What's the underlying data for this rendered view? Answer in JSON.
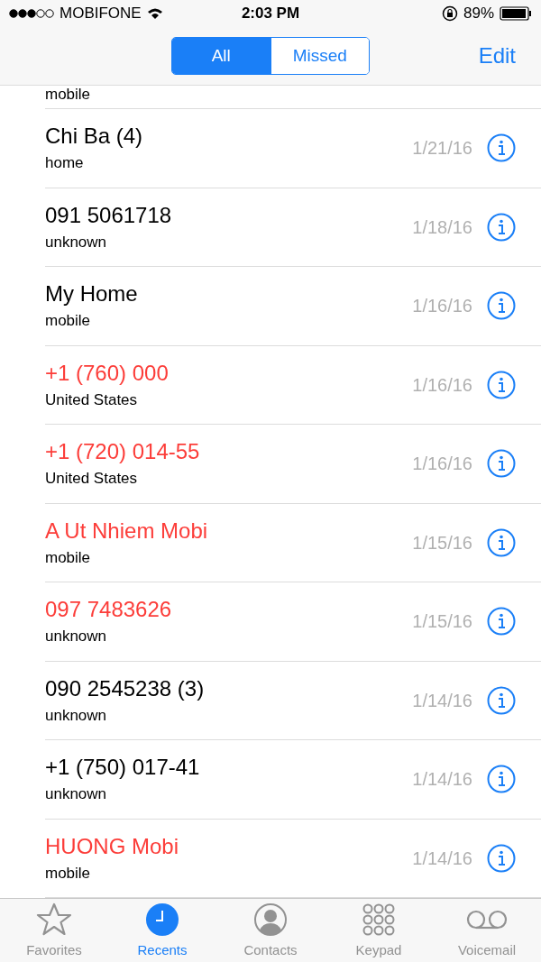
{
  "status_bar": {
    "carrier": "MOBIFONE",
    "time": "2:03 PM",
    "battery": "89%"
  },
  "segments": [
    {
      "label": "All",
      "selected": true
    },
    {
      "label": "Missed",
      "selected": false
    }
  ],
  "edit": "Edit",
  "partial_row": {
    "type": "mobile"
  },
  "calls": [
    {
      "name": "Chi Ba (4)",
      "type": "home",
      "date": "1/21/16",
      "missed": false
    },
    {
      "name": "091 5061718",
      "type": "unknown",
      "date": "1/18/16",
      "missed": false
    },
    {
      "name": "My Home",
      "type": "mobile",
      "date": "1/16/16",
      "missed": false
    },
    {
      "name": "+1 (760) 000",
      "type": "United States",
      "date": "1/16/16",
      "missed": true
    },
    {
      "name": "+1 (720) 014-55",
      "type": "United States",
      "date": "1/16/16",
      "missed": true
    },
    {
      "name": "A Ut Nhiem Mobi",
      "type": "mobile",
      "date": "1/15/16",
      "missed": true
    },
    {
      "name": "097 7483626",
      "type": "unknown",
      "date": "1/15/16",
      "missed": true
    },
    {
      "name": "090 2545238 (3)",
      "type": "unknown",
      "date": "1/14/16",
      "missed": false
    },
    {
      "name": "+1 (750) 017-41",
      "type": "unknown",
      "date": "1/14/16",
      "missed": false
    },
    {
      "name": "HUONG Mobi",
      "type": "mobile",
      "date": "1/14/16",
      "missed": true
    }
  ],
  "tabs": [
    {
      "label": "Favorites",
      "kind": "star",
      "selected": false
    },
    {
      "label": "Recents",
      "kind": "clock",
      "selected": true
    },
    {
      "label": "Contacts",
      "kind": "person",
      "selected": false
    },
    {
      "label": "Keypad",
      "kind": "keypad",
      "selected": false
    },
    {
      "label": "Voicemail",
      "kind": "voicemail",
      "selected": false
    }
  ]
}
